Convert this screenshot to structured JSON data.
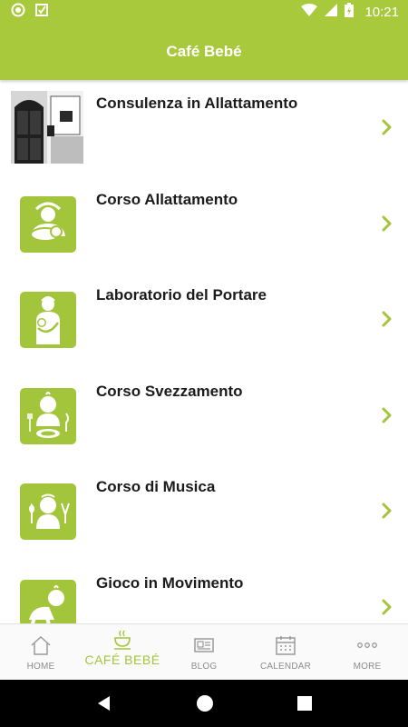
{
  "status_bar": {
    "time": "10:21",
    "icons": [
      "sync-icon",
      "app-notification-icon",
      "wifi-icon",
      "signal-icon",
      "battery-charging-icon"
    ]
  },
  "app_bar": {
    "title": "Café Bebé"
  },
  "list": {
    "items": [
      {
        "title": "Consulenza in Allattamento",
        "icon": "door-photo"
      },
      {
        "title": "Corso Allattamento",
        "icon": "breastfeeding-icon"
      },
      {
        "title": "Laboratorio del Portare",
        "icon": "babywearing-icon"
      },
      {
        "title": "Corso Svezzamento",
        "icon": "weaning-icon"
      },
      {
        "title": "Corso di Musica",
        "icon": "music-icon"
      },
      {
        "title": "Gioco in Movimento",
        "icon": "crawling-baby-icon"
      }
    ]
  },
  "bottom_nav": {
    "items": [
      {
        "label": "HOME",
        "icon": "home-icon",
        "active": false
      },
      {
        "label": "CAFÉ BEBÉ",
        "icon": "cup-icon",
        "active": true
      },
      {
        "label": "BLOG",
        "icon": "blog-icon",
        "active": false
      },
      {
        "label": "CALENDAR",
        "icon": "calendar-icon",
        "active": false
      },
      {
        "label": "MORE",
        "icon": "more-icon",
        "active": false
      }
    ]
  },
  "colors": {
    "brand_green": "#a9c93c",
    "icon_green": "#a3c53b",
    "chevron_green": "#a3c53b",
    "text_dark": "#1b1b1b",
    "nav_gray": "#8c8c8c"
  }
}
